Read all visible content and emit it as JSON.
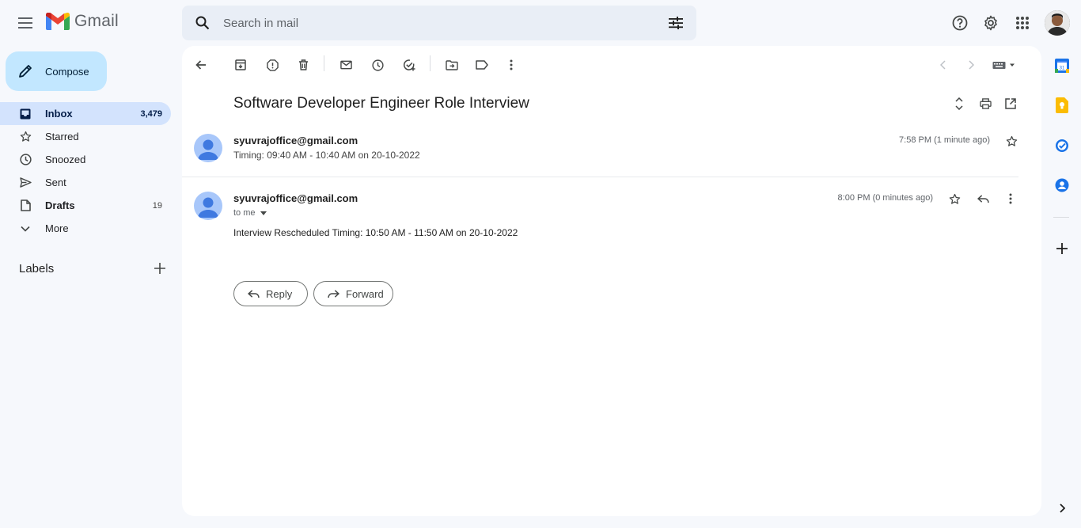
{
  "header": {
    "app_name": "Gmail",
    "search_placeholder": "Search in mail"
  },
  "sidebar": {
    "compose_label": "Compose",
    "items": [
      {
        "label": "Inbox",
        "count": "3,479",
        "icon": "inbox-icon",
        "active": true
      },
      {
        "label": "Starred",
        "count": "",
        "icon": "star-icon"
      },
      {
        "label": "Snoozed",
        "count": "",
        "icon": "clock-icon"
      },
      {
        "label": "Sent",
        "count": "",
        "icon": "send-icon"
      },
      {
        "label": "Drafts",
        "count": "19",
        "icon": "draft-icon"
      },
      {
        "label": "More",
        "count": "",
        "icon": "chevron-down-icon"
      }
    ],
    "labels_heading": "Labels"
  },
  "thread": {
    "subject": "Software Developer Engineer Role Interview",
    "messages": [
      {
        "sender": "syuvrajoffice@gmail.com",
        "snippet": "Timing: 09:40 AM - 10:40 AM on 20-10-2022",
        "time": "7:58 PM (1 minute ago)"
      },
      {
        "sender": "syuvrajoffice@gmail.com",
        "to": "to me",
        "time": "8:00 PM (0 minutes ago)",
        "body": "Interview Rescheduled Timing: 10:50 AM - 11:50 AM on 20-10-2022"
      }
    ],
    "reply_label": "Reply",
    "forward_label": "Forward"
  },
  "colors": {
    "accent": "#0b57d0",
    "compose_bg": "#c2e7ff",
    "active_nav_bg": "#d3e3fd",
    "background": "#f6f8fc"
  }
}
